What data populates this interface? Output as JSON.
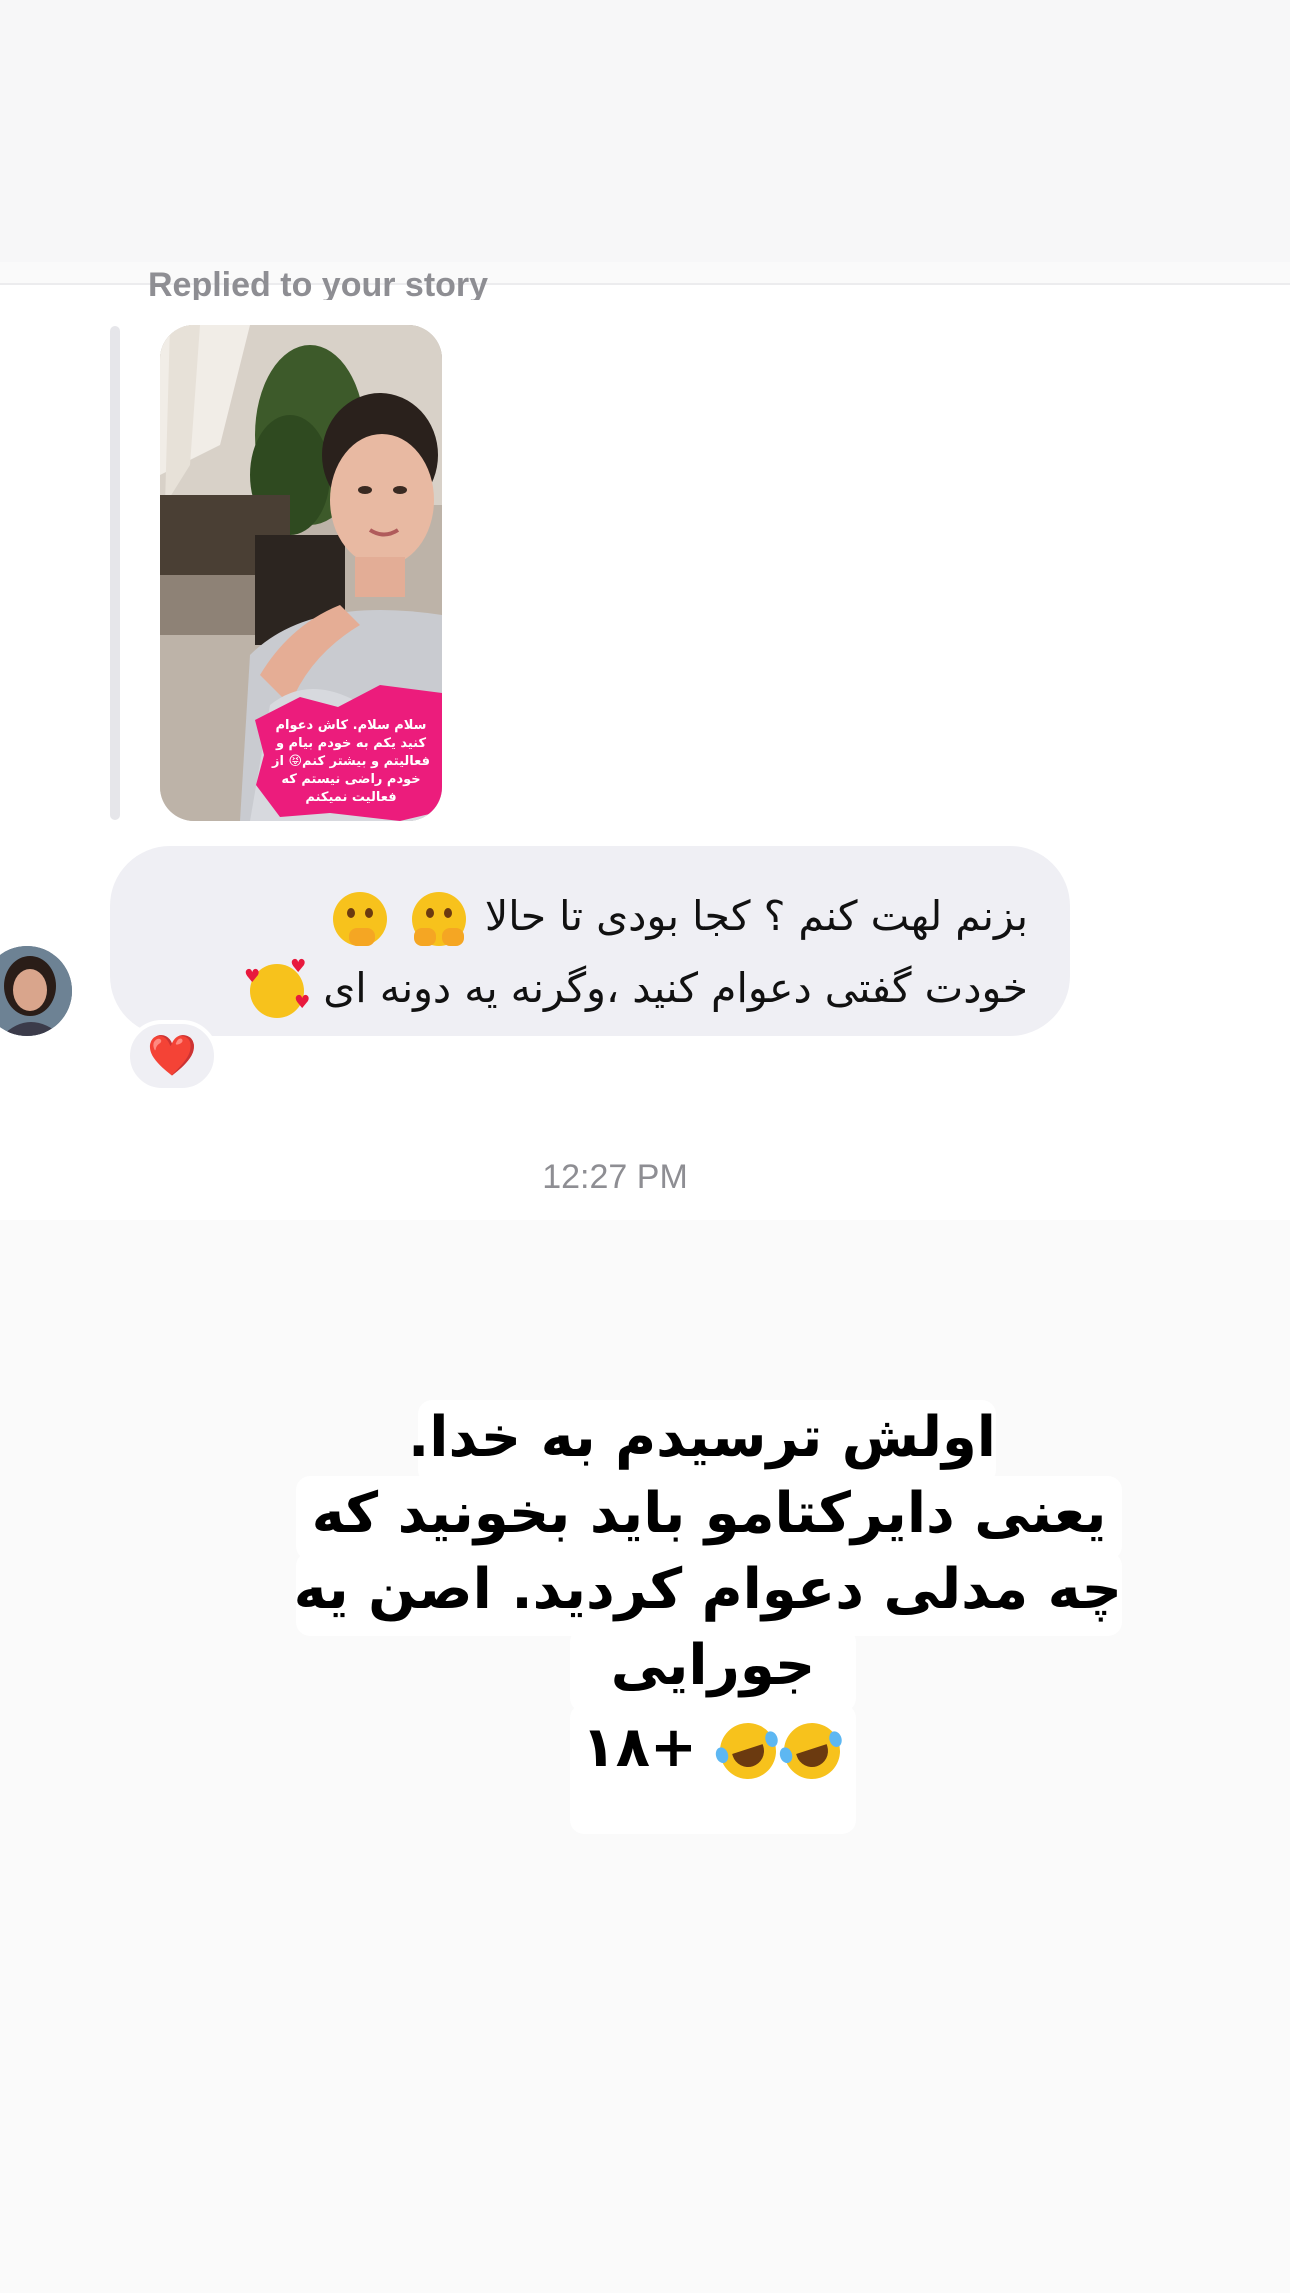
{
  "reply_header": "Replied to your story",
  "story_sticker_text": "سلام سلام. کاش دعوام کنید یکم به خودم بیام و فعالیتم و بیشتر کنم😝 از خودم راضی نیستم که فعالیت نمیکنم",
  "message": {
    "line1": "بزنم لهت کنم ؟ کجا بودی تا حالا",
    "line2": "خودت گفتی دعوام کنید ،وگرنه یه دونه ای",
    "line1_emojis": [
      "face-with-hand-over-mouth-icon",
      "face-with-peeking-eye-icon"
    ],
    "line2_emojis": [
      "smiling-face-with-hearts-icon"
    ]
  },
  "reaction": "❤️",
  "timestamp": "12:27 PM",
  "story_text": {
    "line1": "اولش ترسیدم به خدا.",
    "line2": "یعنی دایرکتامو باید بخونید که",
    "line3": "چه مدلی دعوام کردید. اصن یه",
    "line4": "جورایی",
    "line5": "+۱۸"
  },
  "colors": {
    "bubble": "#efeff4",
    "muted_text": "#8e8e93",
    "background": "#fafafa",
    "heart": "#e01e37",
    "sticker_pink": "#ec1c7c"
  }
}
